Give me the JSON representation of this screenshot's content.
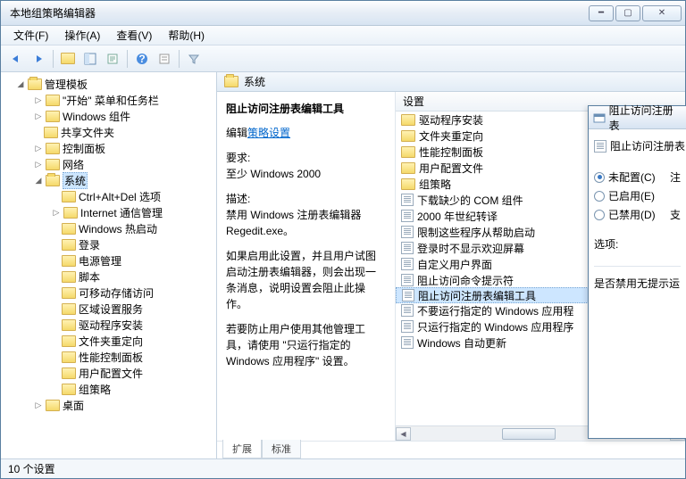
{
  "window": {
    "title": "本地组策略编辑器"
  },
  "menus": {
    "file": "文件(F)",
    "action": "操作(A)",
    "view": "查看(V)",
    "help": "帮助(H)"
  },
  "tree": {
    "root": "管理模板",
    "n1": "\"开始\" 菜单和任务栏",
    "n2": "Windows 组件",
    "n3": "共享文件夹",
    "n4": "控制面板",
    "n5": "网络",
    "n6": "系统",
    "c1": "Ctrl+Alt+Del 选项",
    "c2": "Internet 通信管理",
    "c3": "Windows 热启动",
    "c4": "登录",
    "c5": "电源管理",
    "c6": "脚本",
    "c7": "可移动存储访问",
    "c8": "区域设置服务",
    "c9": "驱动程序安装",
    "c10": "文件夹重定向",
    "c11": "性能控制面板",
    "c12": "用户配置文件",
    "c13": "组策略",
    "n7": "桌面"
  },
  "path": {
    "label": "系统"
  },
  "desc": {
    "title": "阻止访问注册表编辑工具",
    "editPrefix": "编辑",
    "editLink": "策略设置",
    "reqLabel": "要求:",
    "reqValue": "至少 Windows 2000",
    "descrLabel": "描述:",
    "descr1": "禁用 Windows 注册表编辑器 Regedit.exe。",
    "descr2": "如果启用此设置，并且用户试图启动注册表编辑器，则会出现一条消息，说明设置会阻止此操作。",
    "descr3": "若要防止用户使用其他管理工具，请使用 \"只运行指定的 Windows 应用程序\" 设置。"
  },
  "listHeader": "设置",
  "list": {
    "i1": "驱动程序安装",
    "i2": "文件夹重定向",
    "i3": "性能控制面板",
    "i4": "用户配置文件",
    "i5": "组策略",
    "i6": "下载缺少的 COM 组件",
    "i7": "2000 年世纪转译",
    "i8": "限制这些程序从帮助启动",
    "i9": "登录时不显示欢迎屏幕",
    "i10": "自定义用户界面",
    "i11": "阻止访问命令提示符",
    "i12": "阻止访问注册表编辑工具",
    "i13": "不要运行指定的 Windows 应用程",
    "i14": "只运行指定的 Windows 应用程序",
    "i15": "Windows 自动更新"
  },
  "tabs": {
    "ext": "扩展",
    "std": "标准"
  },
  "status": "10 个设置",
  "dialog": {
    "title": "阻止访问注册表",
    "heading": "阻止访问注册表",
    "opt1": "未配置(C)",
    "opt2": "已启用(E)",
    "opt3": "已禁用(D)",
    "sideLabel1": "注",
    "sideLabel2": "支",
    "optionsLabel": "选项:",
    "body": "是否禁用无提示运"
  }
}
